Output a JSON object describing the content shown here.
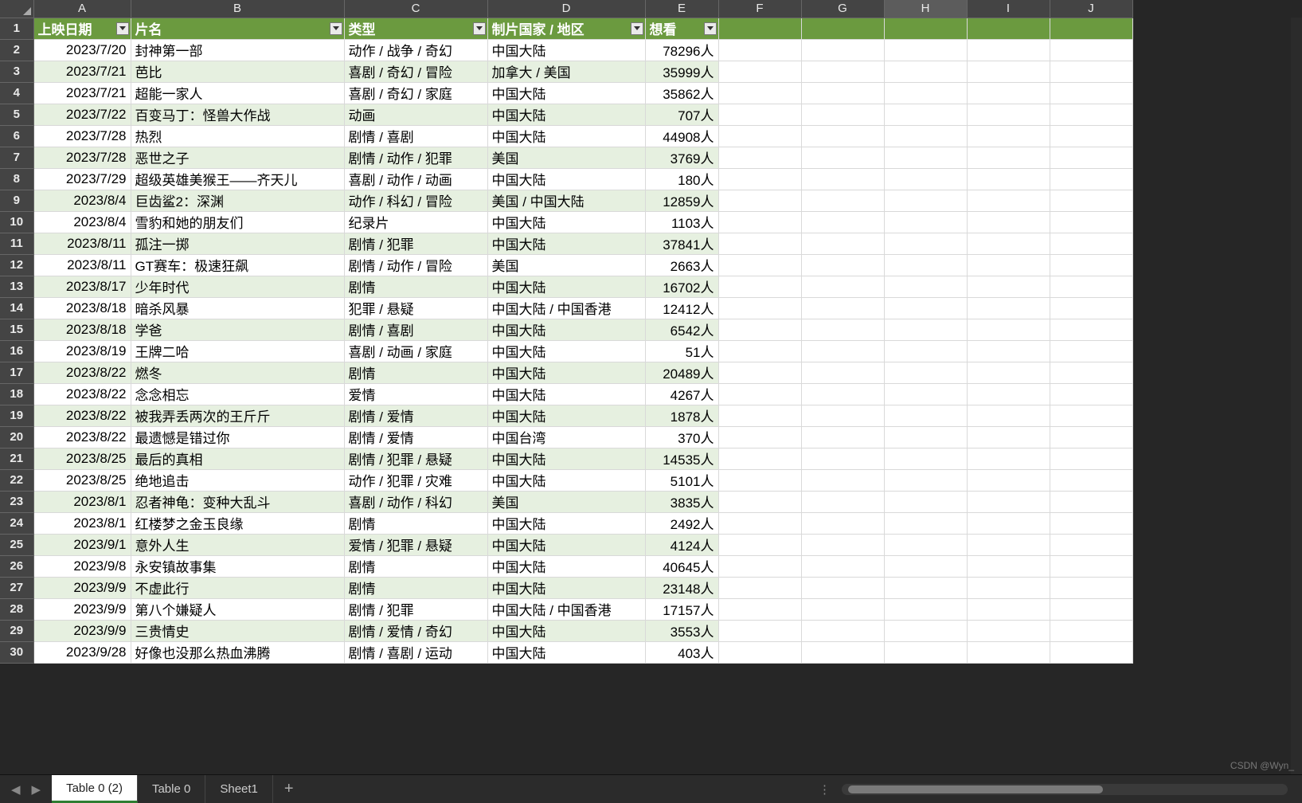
{
  "columns_letters": [
    "A",
    "B",
    "C",
    "D",
    "E",
    "F",
    "G",
    "H",
    "I",
    "J"
  ],
  "selected_col_idx": 7,
  "headers": [
    "上映日期",
    "片名",
    "类型",
    "制片国家 / 地区",
    "想看"
  ],
  "rows": [
    {
      "a": "2023/7/20",
      "b": "封神第一部",
      "c": "动作 / 战争 / 奇幻",
      "d": "中国大陆",
      "e": "78296人"
    },
    {
      "a": "2023/7/21",
      "b": "芭比",
      "c": "喜剧 / 奇幻 / 冒险",
      "d": "加拿大 / 美国",
      "e": "35999人"
    },
    {
      "a": "2023/7/21",
      "b": "超能一家人",
      "c": "喜剧 / 奇幻 / 家庭",
      "d": "中国大陆",
      "e": "35862人"
    },
    {
      "a": "2023/7/22",
      "b": "百变马丁：怪兽大作战",
      "c": "动画",
      "d": "中国大陆",
      "e": "707人"
    },
    {
      "a": "2023/7/28",
      "b": "热烈",
      "c": "剧情 / 喜剧",
      "d": "中国大陆",
      "e": "44908人"
    },
    {
      "a": "2023/7/28",
      "b": "恶世之子",
      "c": "剧情 / 动作 / 犯罪",
      "d": "美国",
      "e": "3769人"
    },
    {
      "a": "2023/7/29",
      "b": "超级英雄美猴王——齐天儿",
      "c": "喜剧 / 动作 / 动画",
      "d": "中国大陆",
      "e": "180人"
    },
    {
      "a": "2023/8/4",
      "b": "巨齿鲨2：深渊",
      "c": "动作 / 科幻 / 冒险",
      "d": "美国 / 中国大陆",
      "e": "12859人"
    },
    {
      "a": "2023/8/4",
      "b": "雪豹和她的朋友们",
      "c": "纪录片",
      "d": "中国大陆",
      "e": "1103人"
    },
    {
      "a": "2023/8/11",
      "b": "孤注一掷",
      "c": "剧情 / 犯罪",
      "d": "中国大陆",
      "e": "37841人"
    },
    {
      "a": "2023/8/11",
      "b": "GT赛车：极速狂飙",
      "c": "剧情 / 动作 / 冒险",
      "d": "美国",
      "e": "2663人"
    },
    {
      "a": "2023/8/17",
      "b": "少年时代",
      "c": "剧情",
      "d": "中国大陆",
      "e": "16702人"
    },
    {
      "a": "2023/8/18",
      "b": "暗杀风暴",
      "c": "犯罪 / 悬疑",
      "d": "中国大陆 / 中国香港",
      "e": "12412人"
    },
    {
      "a": "2023/8/18",
      "b": "学爸",
      "c": "剧情 / 喜剧",
      "d": "中国大陆",
      "e": "6542人"
    },
    {
      "a": "2023/8/19",
      "b": "王牌二哈",
      "c": "喜剧 / 动画 / 家庭",
      "d": "中国大陆",
      "e": "51人"
    },
    {
      "a": "2023/8/22",
      "b": "燃冬",
      "c": "剧情",
      "d": "中国大陆",
      "e": "20489人"
    },
    {
      "a": "2023/8/22",
      "b": "念念相忘",
      "c": "爱情",
      "d": "中国大陆",
      "e": "4267人"
    },
    {
      "a": "2023/8/22",
      "b": "被我弄丢两次的王斤斤",
      "c": "剧情 / 爱情",
      "d": "中国大陆",
      "e": "1878人"
    },
    {
      "a": "2023/8/22",
      "b": "最遗憾是错过你",
      "c": "剧情 / 爱情",
      "d": "中国台湾",
      "e": "370人"
    },
    {
      "a": "2023/8/25",
      "b": "最后的真相",
      "c": "剧情 / 犯罪 / 悬疑",
      "d": "中国大陆",
      "e": "14535人"
    },
    {
      "a": "2023/8/25",
      "b": "绝地追击",
      "c": "动作 / 犯罪 / 灾难",
      "d": "中国大陆",
      "e": "5101人"
    },
    {
      "a": "2023/8/1",
      "b": "忍者神龟：变种大乱斗",
      "c": "喜剧 / 动作 / 科幻",
      "d": "美国",
      "e": "3835人"
    },
    {
      "a": "2023/8/1",
      "b": "红楼梦之金玉良缘",
      "c": "剧情",
      "d": "中国大陆",
      "e": "2492人"
    },
    {
      "a": "2023/9/1",
      "b": "意外人生",
      "c": "爱情 / 犯罪 / 悬疑",
      "d": "中国大陆",
      "e": "4124人"
    },
    {
      "a": "2023/9/8",
      "b": "永安镇故事集",
      "c": "剧情",
      "d": "中国大陆",
      "e": "40645人"
    },
    {
      "a": "2023/9/9",
      "b": "不虚此行",
      "c": "剧情",
      "d": "中国大陆",
      "e": "23148人"
    },
    {
      "a": "2023/9/9",
      "b": "第八个嫌疑人",
      "c": "剧情 / 犯罪",
      "d": "中国大陆 / 中国香港",
      "e": "17157人"
    },
    {
      "a": "2023/9/9",
      "b": "三贵情史",
      "c": "剧情 / 爱情 / 奇幻",
      "d": "中国大陆",
      "e": "3553人"
    },
    {
      "a": "2023/9/28",
      "b": "好像也没那么热血沸腾",
      "c": "剧情 / 喜剧 / 运动",
      "d": "中国大陆",
      "e": "403人"
    }
  ],
  "sheet_tabs": [
    "Table 0 (2)",
    "Table 0",
    "Sheet1"
  ],
  "active_tab": 0,
  "watermark": "CSDN @Wyn_"
}
